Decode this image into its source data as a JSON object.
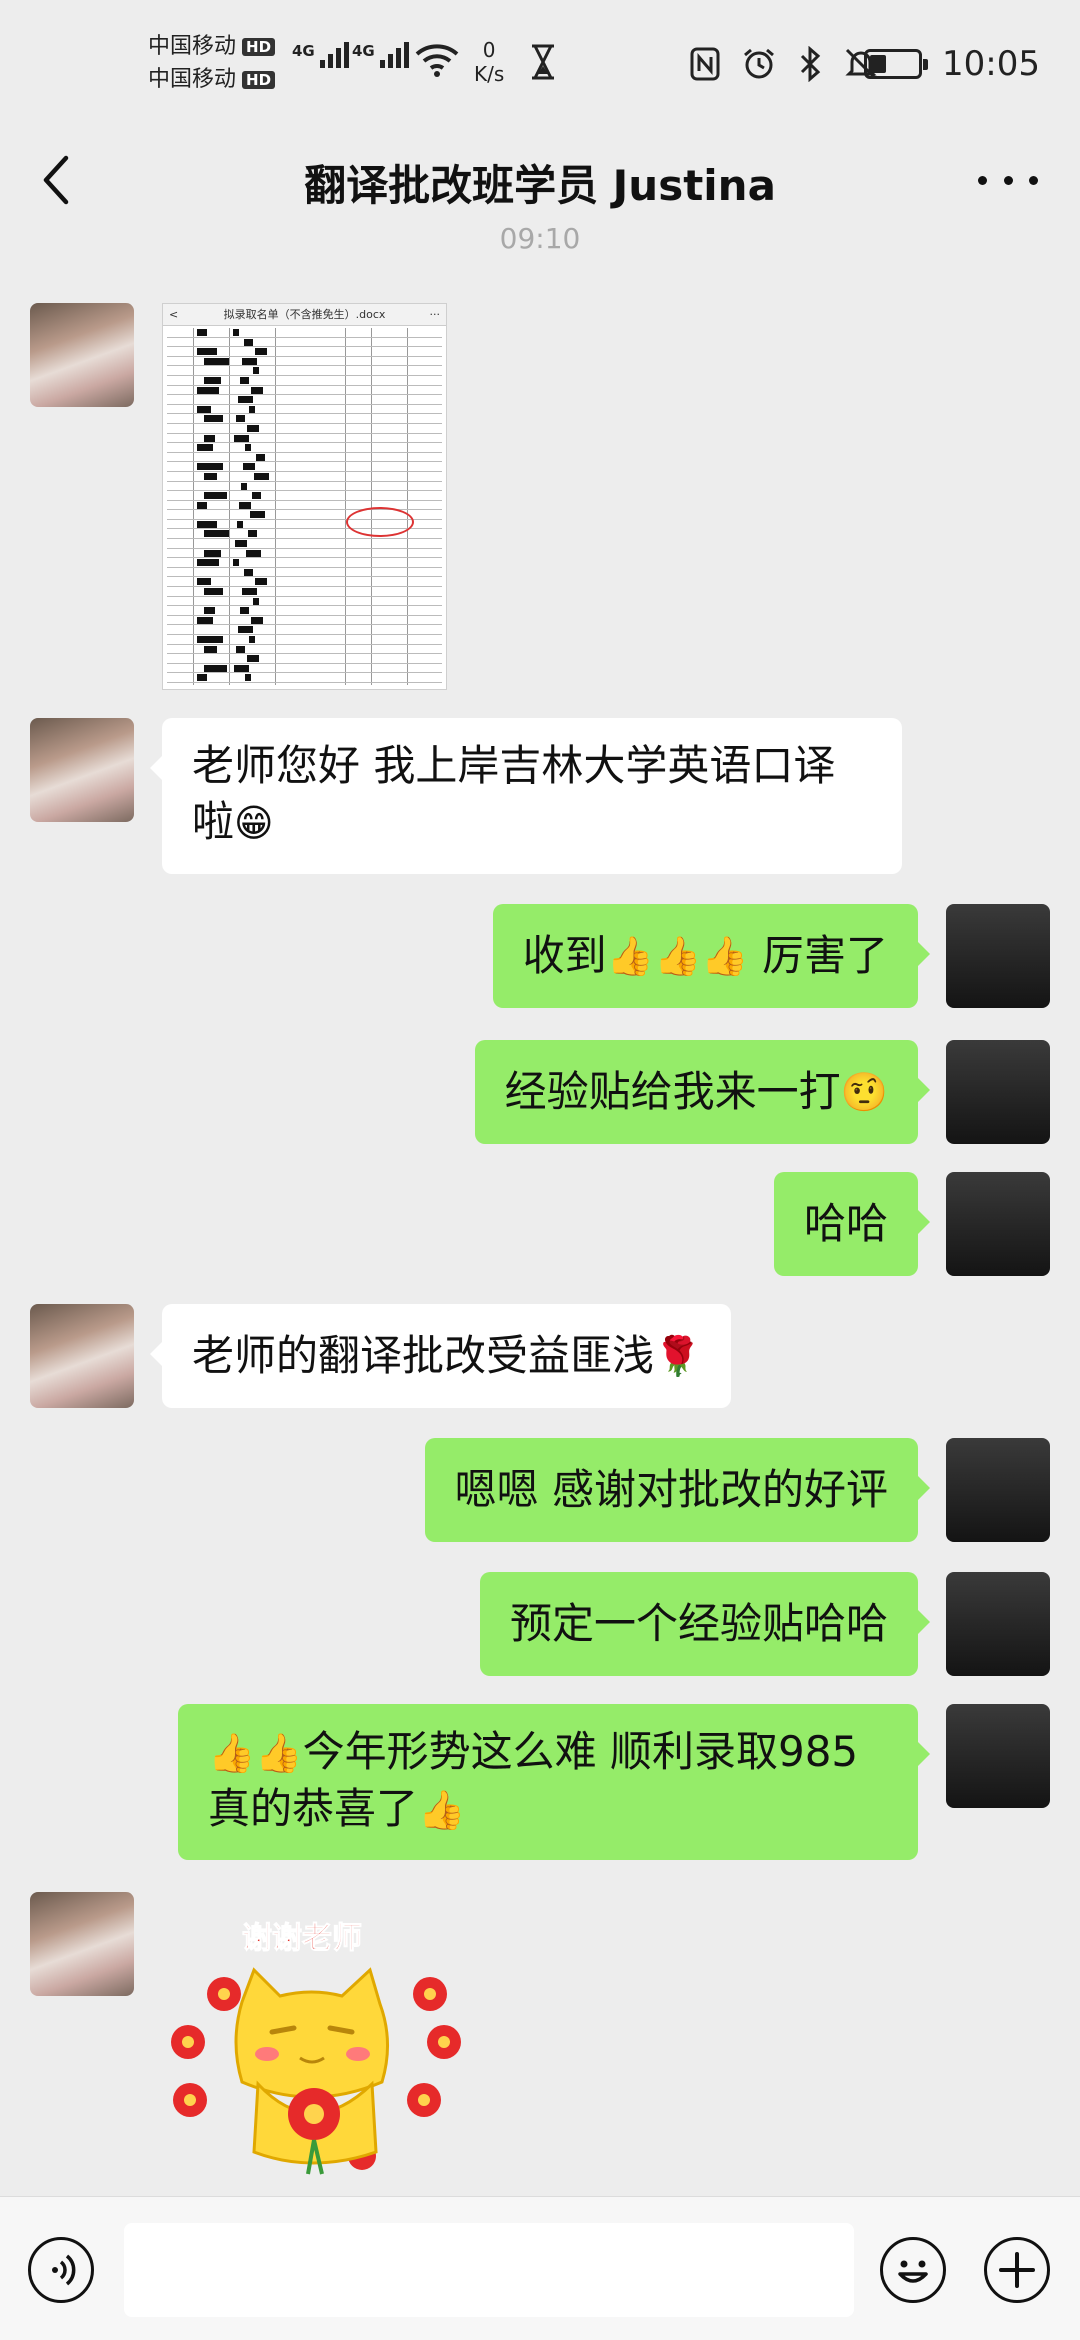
{
  "status_bar": {
    "carrier_1": "中国移动",
    "carrier_2": "中国移动",
    "hd_badge": "HD",
    "network_1": "4G",
    "network_2": "4G",
    "speed_value": "0",
    "speed_unit": "K/s",
    "time": "10:05",
    "icons": [
      "nfc-icon",
      "alarm-icon",
      "bluetooth-icon",
      "mute-icon",
      "battery-icon"
    ]
  },
  "header": {
    "title": "翻译批改班学员 Justina",
    "back_icon": "chevron-left-icon",
    "more_icon": "more-dots-icon"
  },
  "chat": {
    "timestamp": "09:10",
    "document_image": {
      "header_text": "拟录取名单（不含推免生）.docx",
      "header_back": "<",
      "header_more": "···"
    },
    "messages": [
      {
        "sender": "student",
        "text": "老师您好 我上岸吉林大学英语口译",
        "text_line2": "啦",
        "emoji": "😁"
      },
      {
        "sender": "teacher",
        "text": "收到",
        "emoji": "👍👍👍",
        "text_after": " 厉害了"
      },
      {
        "sender": "teacher",
        "text": "经验贴给我来一打",
        "emoji": "🤨"
      },
      {
        "sender": "teacher",
        "text": "哈哈"
      },
      {
        "sender": "student",
        "text": "老师的翻译批改受益匪浅",
        "emoji": "🌹"
      },
      {
        "sender": "teacher",
        "text": "嗯嗯 感谢对批改的好评"
      },
      {
        "sender": "teacher",
        "text": "预定一个经验贴哈哈"
      },
      {
        "sender": "teacher",
        "emoji_before": "👍👍",
        "text": "今年形势这么难 顺利录取985",
        "text_line2": "真的恭喜了",
        "emoji": "👍"
      }
    ],
    "sticker": {
      "caption": "谢谢老师",
      "icon": "thank-you-cat-sticker"
    }
  },
  "input_bar": {
    "voice_icon": "voice-icon",
    "placeholder": "",
    "emoji_icon": "emoji-icon",
    "plus_icon": "plus-icon"
  },
  "colors": {
    "chat_background": "#ededed",
    "outgoing_bubble": "#95ec69",
    "incoming_bubble": "#ffffff",
    "timestamp_text": "#a8a8a8"
  }
}
